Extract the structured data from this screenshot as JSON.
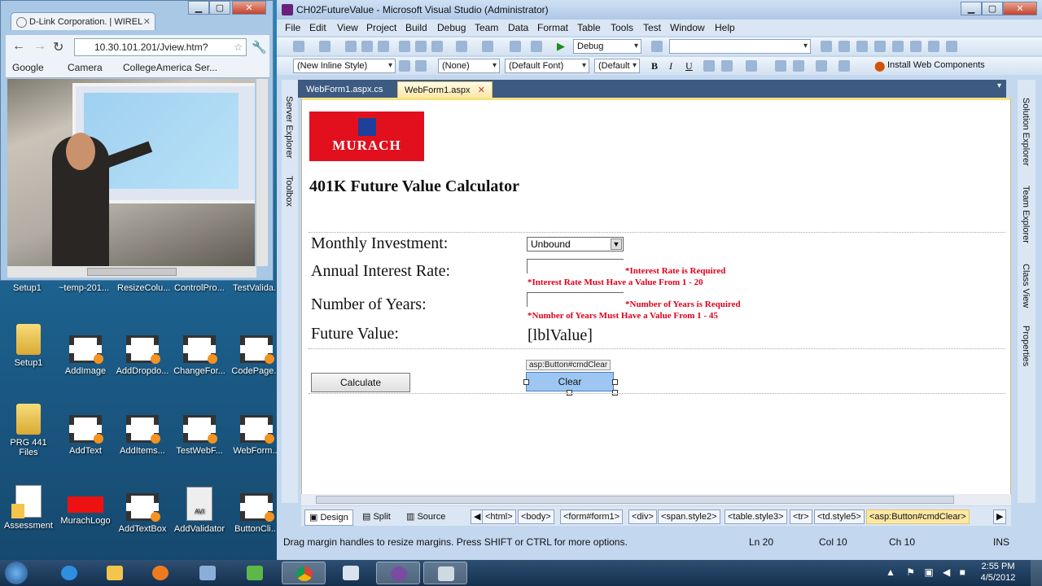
{
  "browser": {
    "tab_title": "D-Link Corporation. | WIREL",
    "url": "10.30.101.201/Jview.htm?",
    "bookmarks": [
      "Google",
      "Camera",
      "CollegeAmerica Ser..."
    ],
    "partial_labels": [
      "Setup1",
      "~temp-201...",
      "ResizeColu...",
      "ControlPro...",
      "TestValida..."
    ]
  },
  "desktop_icons": [
    {
      "label": "Setup1",
      "icon": "folder-icon"
    },
    {
      "label": "AddImage",
      "icon": "video-file-icon"
    },
    {
      "label": "AddDropdo...",
      "icon": "video-file-icon"
    },
    {
      "label": "ChangeFor...",
      "icon": "video-file-icon"
    },
    {
      "label": "CodePage...",
      "icon": "video-file-icon"
    },
    {
      "label": "PRG 441 Files",
      "icon": "folder-icon"
    },
    {
      "label": "AddText",
      "icon": "video-file-icon"
    },
    {
      "label": "AddItems...",
      "icon": "video-file-icon"
    },
    {
      "label": "TestWebF...",
      "icon": "video-file-icon"
    },
    {
      "label": "WebForm...",
      "icon": "video-file-icon"
    },
    {
      "label": "Assessment",
      "icon": "document-icon"
    },
    {
      "label": "MurachLogo",
      "icon": "murach-image-icon"
    },
    {
      "label": "AddTextBox",
      "icon": "video-file-icon"
    },
    {
      "label": "AddValidator",
      "icon": "avi-file-icon"
    },
    {
      "label": "ButtonCli...",
      "icon": "video-file-icon"
    }
  ],
  "vs": {
    "title": "CH02FutureValue - Microsoft Visual Studio (Administrator)",
    "menu": [
      "File",
      "Edit",
      "View",
      "Project",
      "Build",
      "Debug",
      "Team",
      "Data",
      "Format",
      "Table",
      "Tools",
      "Test",
      "Window",
      "Help"
    ],
    "toolbar": {
      "config": "Debug",
      "style_combo": "(New Inline Style)",
      "none_combo": "(None)",
      "font_combo": "(Default Font)",
      "size_combo": "(Default",
      "install": "Install Web Components",
      "bold": "B",
      "italic": "I",
      "underline": "U"
    },
    "left_panels": [
      "Server Explorer",
      "Toolbox"
    ],
    "right_panels": [
      "Solution Explorer",
      "Team Explorer",
      "Class View",
      "Properties"
    ],
    "doc_tabs": [
      {
        "label": "WebForm1.aspx.cs",
        "active": false
      },
      {
        "label": "WebForm1.aspx",
        "active": true
      }
    ],
    "page": {
      "logo_text": "MURACH",
      "heading": "401K Future Value Calculator",
      "labels": {
        "investment": "Monthly Investment:",
        "rate": "Annual Interest Rate:",
        "years": "Number of Years:",
        "future": "Future Value:"
      },
      "dropdown_value": "Unbound",
      "errors": {
        "rate_required": "*Interest Rate is Required",
        "rate_range": "*Interest Rate Must Have a Value From 1 - 20",
        "years_required": "*Number of Years is Required",
        "years_range": "*Number of Years Must Have a Value From 1 - 45"
      },
      "lbl_value": "[lblValue]",
      "calculate_label": "Calculate",
      "clear_label": "Clear",
      "selected_tag": "asp:Button#cmdClear"
    },
    "view_tabs": [
      "Design",
      "Split",
      "Source"
    ],
    "breadcrumbs": [
      "<html>",
      "<body>",
      "<form#form1>",
      "<div>",
      "<span.style2>",
      "<table.style3>",
      "<tr>",
      "<td.style5>",
      "<asp:Button#cmdClear>"
    ],
    "status": {
      "message": "Drag margin handles to resize margins. Press SHIFT or CTRL for more options.",
      "line": "Ln 20",
      "col": "Col 10",
      "ch": "Ch 10",
      "mode": "INS"
    }
  },
  "taskbar": {
    "time": "2:55 PM",
    "date": "4/5/2012"
  }
}
